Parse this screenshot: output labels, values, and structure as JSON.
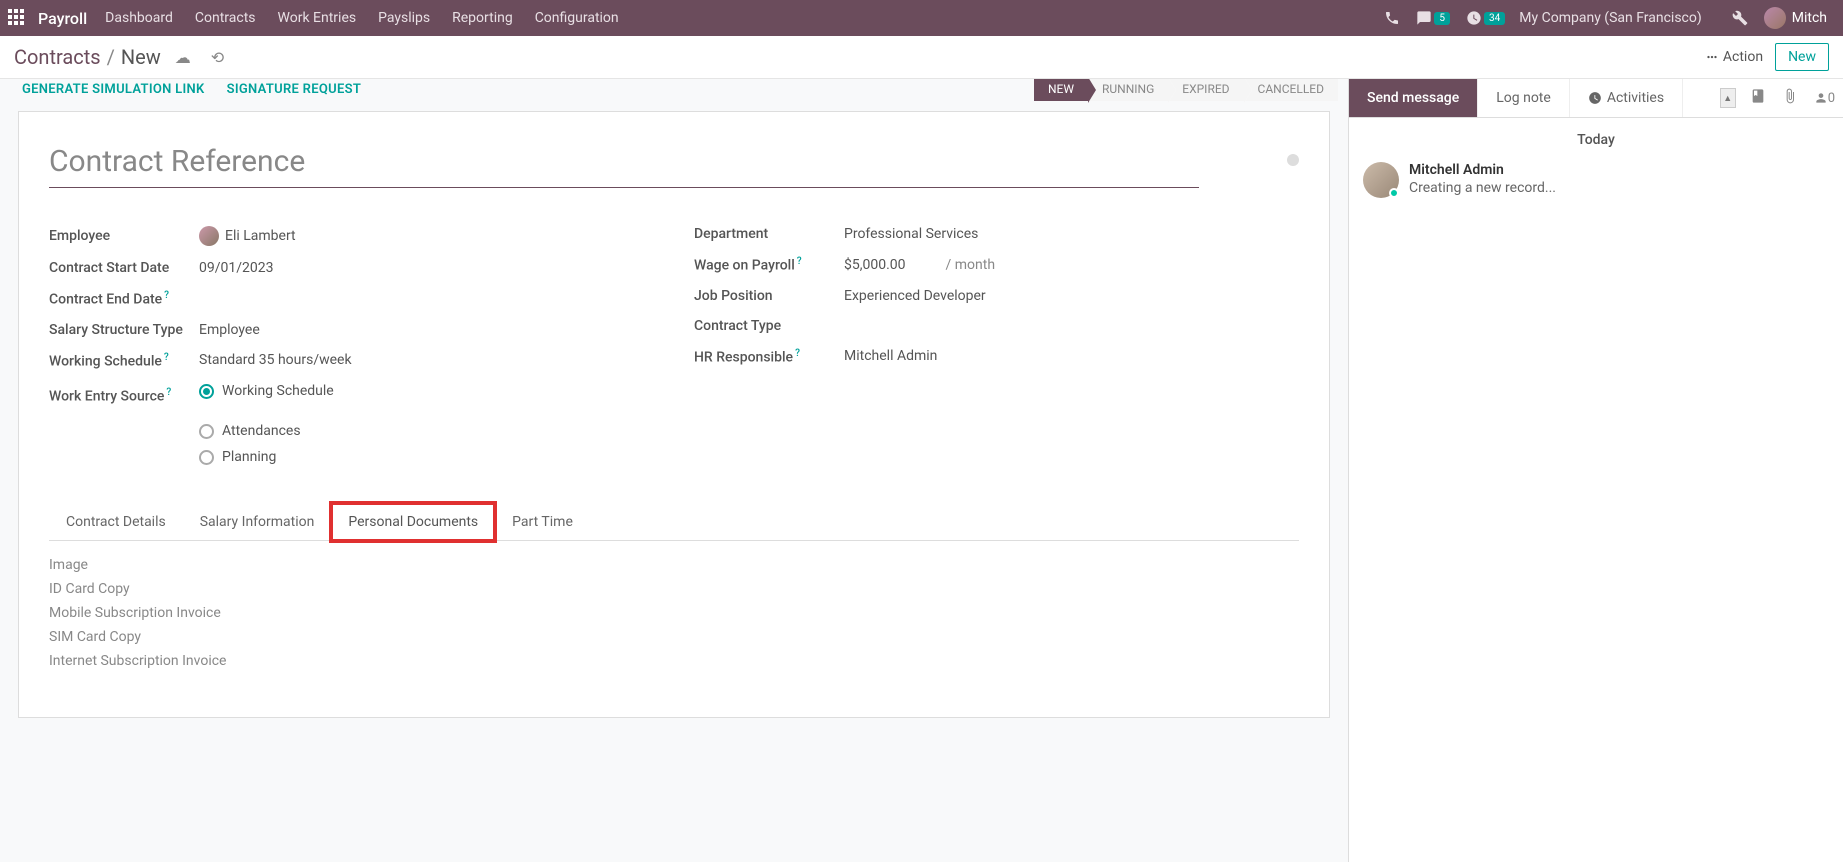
{
  "nav": {
    "brand": "Payroll",
    "links": [
      "Dashboard",
      "Contracts",
      "Work Entries",
      "Payslips",
      "Reporting",
      "Configuration"
    ],
    "msg_badge": "5",
    "activity_badge": "34",
    "company": "My Company (San Francisco)",
    "user": "Mitch"
  },
  "breadcrumb": {
    "root": "Contracts",
    "current": "New",
    "action_label": "Action",
    "new_label": "New"
  },
  "top_actions": {
    "gen_link": "GENERATE SIMULATION LINK",
    "sig_req": "SIGNATURE REQUEST"
  },
  "status": [
    "NEW",
    "RUNNING",
    "EXPIRED",
    "CANCELLED"
  ],
  "form": {
    "title_placeholder": "Contract Reference",
    "left": {
      "employee_label": "Employee",
      "employee_value": "Eli Lambert",
      "start_label": "Contract Start Date",
      "start_value": "09/01/2023",
      "end_label": "Contract End Date",
      "structure_label": "Salary Structure Type",
      "structure_value": "Employee",
      "schedule_label": "Working Schedule",
      "schedule_value": "Standard 35 hours/week",
      "source_label": "Work Entry Source",
      "source_options": [
        "Working Schedule",
        "Attendances",
        "Planning"
      ]
    },
    "right": {
      "dept_label": "Department",
      "dept_value": "Professional Services",
      "wage_label": "Wage on Payroll",
      "wage_value": "$5,000.00",
      "wage_unit": "/ month",
      "pos_label": "Job Position",
      "pos_value": "Experienced Developer",
      "ctype_label": "Contract Type",
      "hr_label": "HR Responsible",
      "hr_value": "Mitchell Admin"
    }
  },
  "tabs": [
    "Contract Details",
    "Salary Information",
    "Personal Documents",
    "Part Time"
  ],
  "docs": [
    "Image",
    "ID Card Copy",
    "Mobile Subscription Invoice",
    "SIM Card Copy",
    "Internet Subscription Invoice"
  ],
  "chat": {
    "send": "Send message",
    "log": "Log note",
    "activities": "Activities",
    "followers": "0",
    "today": "Today",
    "author": "Mitchell Admin",
    "message": "Creating a new record..."
  }
}
